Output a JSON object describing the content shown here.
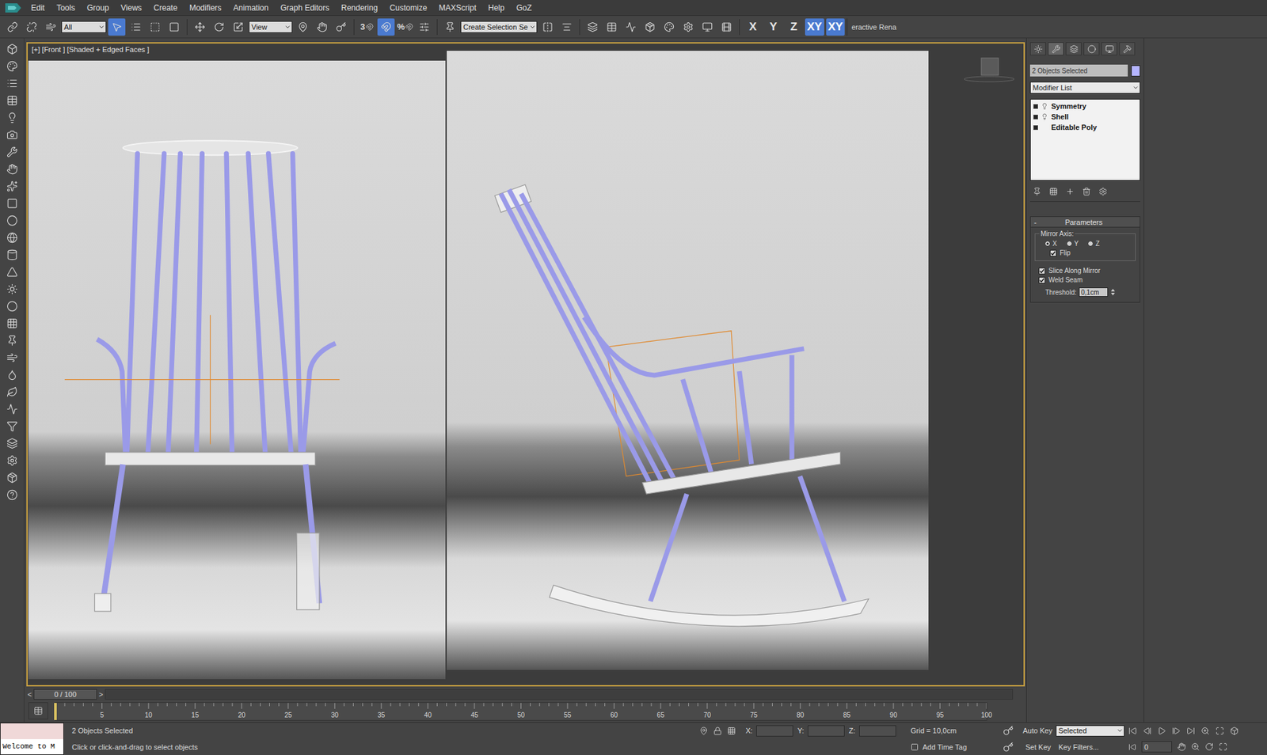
{
  "window": {
    "title": "3ds Max"
  },
  "menu": [
    "Edit",
    "Tools",
    "Group",
    "Views",
    "Create",
    "Modifiers",
    "Animation",
    "Graph Editors",
    "Rendering",
    "Customize",
    "MAXScript",
    "Help",
    "GoZ"
  ],
  "toolbar": {
    "selection_filter": "All",
    "reference_coord": "View",
    "named_selection": "Create Selection Se",
    "select_object": {
      "selected": true
    },
    "snap": {
      "label": "3",
      "selected": false
    },
    "angle_snap": {
      "selected": true
    },
    "percent_snap": {
      "label": "%",
      "selected": false
    },
    "axis_buttons": [
      {
        "label": "X",
        "selected": false
      },
      {
        "label": "Y",
        "selected": false
      },
      {
        "label": "Z",
        "selected": false
      },
      {
        "label": "XY",
        "selected": true
      },
      {
        "label": "XY",
        "selected": true
      }
    ],
    "render_button": "eractive Rena"
  },
  "viewport": {
    "label": "[+] [Front ] [Shaded + Edged Faces ]",
    "active": true
  },
  "command_panel": {
    "tabs": [
      {
        "kind": "create",
        "selected": false
      },
      {
        "kind": "modify",
        "selected": true
      },
      {
        "kind": "hierarchy",
        "selected": false
      },
      {
        "kind": "motion",
        "selected": false
      },
      {
        "kind": "display",
        "selected": false
      },
      {
        "kind": "utilities",
        "selected": false
      }
    ],
    "object_name": "2 Objects Selected",
    "object_color": "#b4b4ff",
    "modifier_list": "Modifier List",
    "stack": [
      {
        "label": "Symmetry",
        "kind": "modifier",
        "selected": false
      },
      {
        "label": "Shell",
        "kind": "modifier",
        "selected": false
      },
      {
        "label": "Editable Poly",
        "kind": "base",
        "selected": false
      }
    ],
    "rollout": {
      "collapse": "-",
      "title": "Parameters",
      "mirror_axis_label": "Mirror Axis:",
      "axes": [
        {
          "label": "X",
          "selected": true
        },
        {
          "label": "Y",
          "selected": false
        },
        {
          "label": "Z",
          "selected": false
        }
      ],
      "flip": {
        "label": "Flip",
        "checked": true
      },
      "options": [
        {
          "label": "Slice Along Mirror",
          "checked": true
        },
        {
          "label": "Weld Seam",
          "checked": true
        }
      ],
      "threshold": {
        "label": "Threshold:",
        "value": "0,1cm"
      }
    }
  },
  "timeline": {
    "prev": "<",
    "frame": "0 / 100",
    "next": ">",
    "ticks": [
      "5",
      "10",
      "15",
      "20",
      "25",
      "30",
      "35",
      "40",
      "45",
      "50",
      "55",
      "60",
      "65",
      "70",
      "75",
      "80",
      "85",
      "90",
      "95",
      "100"
    ]
  },
  "status_bar": {
    "listener": "Welcome to M",
    "selection": "2 Objects Selected",
    "prompt": "Click or click-and-drag to select objects",
    "coords": [
      {
        "label": "X:",
        "value": ""
      },
      {
        "label": "Y:",
        "value": ""
      },
      {
        "label": "Z:",
        "value": ""
      }
    ],
    "grid": "Grid = 10,0cm",
    "time_tag": "Add Time Tag",
    "auto_key": "Auto Key",
    "key_mode": "Selected",
    "set_key": "Set Key",
    "key_filters": "Key Filters...",
    "frame": "0"
  }
}
